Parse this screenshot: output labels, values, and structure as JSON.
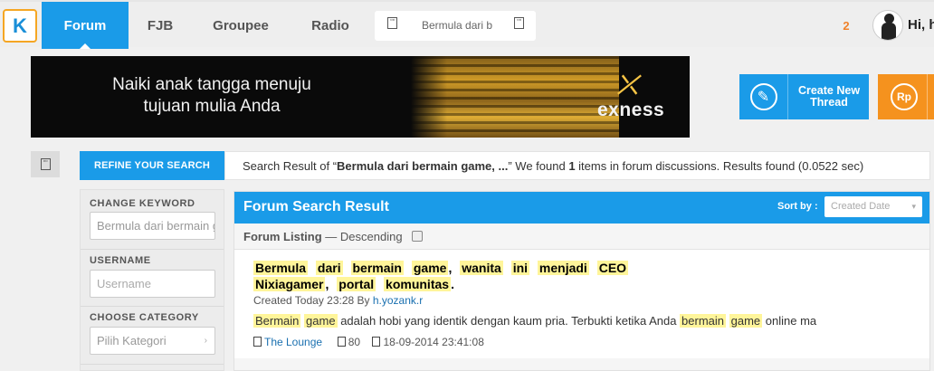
{
  "nav": {
    "logo": "K",
    "tabs": [
      {
        "label": "Forum",
        "active": true
      },
      {
        "label": "FJB",
        "active": false
      },
      {
        "label": "Groupee",
        "active": false
      },
      {
        "label": "Radio",
        "active": false
      }
    ],
    "search_tab_text": "Bermula dari b",
    "notification_count": "2",
    "greeting": "Hi, h"
  },
  "banner": {
    "line1": "Naiki anak tangga menuju",
    "line2": "tujuan mulia Anda",
    "brand": "exness"
  },
  "actions": {
    "create_thread_line1": "Create New",
    "create_thread_line2": "Thread",
    "rp_label": "Rp"
  },
  "refine": {
    "tab_label": "REFINE YOUR SEARCH",
    "result_prefix": "Search Result of “",
    "result_query": "Bermula dari bermain game, ...",
    "result_mid": "” We found ",
    "result_count": "1",
    "result_suffix": " items in forum discussions. Results found (0.0522 sec)"
  },
  "sidebar": {
    "keyword_label": "CHANGE KEYWORD",
    "keyword_value": "Bermula dari bermain game",
    "username_label": "USERNAME",
    "username_placeholder": "Username",
    "category_label": "CHOOSE CATEGORY",
    "category_placeholder": "Pilih Kategori"
  },
  "results": {
    "title": "Forum Search Result",
    "sort_label": "Sort by :",
    "sort_value": "Created Date",
    "listing_label": "Forum Listing",
    "listing_order": " — Descending",
    "thread": {
      "title_words": [
        "Bermula",
        "dari",
        "bermain",
        "game",
        ",",
        "wanita",
        "ini",
        "menjadi",
        "CEO",
        "Nixiagamer",
        ",",
        "portal",
        "komunitas",
        "."
      ],
      "meta_prefix": "Created Today 23:28 By ",
      "author": "h.yozank.r",
      "snippet_hl1": "Bermain",
      "snippet_hl2": "game",
      "snippet_mid": " adalah hobi yang identik dengan kaum pria. Terbukti ketika Anda ",
      "snippet_hl3": "bermain",
      "snippet_hl4": "game",
      "snippet_end": " online ma",
      "category": "The Lounge",
      "views": "80",
      "date": "18-09-2014 23:41:08"
    }
  },
  "colors": {
    "primary": "#1a9be8",
    "orange": "#f5921e",
    "highlight": "#fff59a"
  }
}
